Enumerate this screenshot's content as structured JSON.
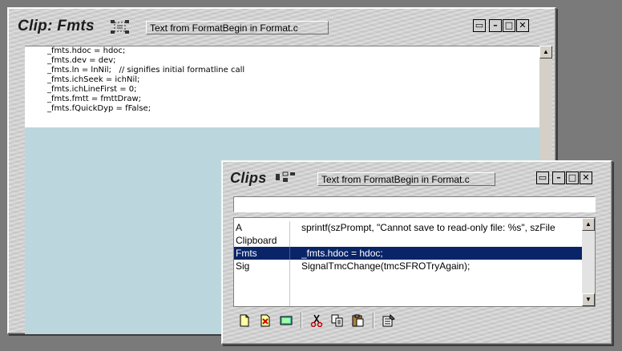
{
  "main_window": {
    "title": "Clip: Fmts",
    "description": "Text from FormatBegin in Format.c",
    "icon": "multi-clip-icon",
    "code_lines": [
      "_fmts.hdoc = hdoc;",
      "_fmts.dev = dev;",
      "_fmts.ln = lnNil;   // signifies initial formatline call",
      "_fmts.ichSeek = ichNil;",
      "_fmts.ichLineFirst = 0;",
      "_fmts.fmtt = fmttDraw;",
      "_fmts.fQuickDyp = fFalse;"
    ],
    "buttons": {
      "restore": "▭",
      "minimize": "–",
      "maximize": "□",
      "close": "✕"
    }
  },
  "clips_window": {
    "title": "Clips",
    "description": "Text from FormatBegin in Format.c",
    "icon": "clips-icon",
    "input_value": "",
    "rows": [
      {
        "name": "A",
        "text": "sprintf(szPrompt, \"Cannot save to read-only file: %s\", szFile"
      },
      {
        "name": "Clipboard",
        "text": ""
      },
      {
        "name": "Fmts",
        "text": "_fmts.hdoc = hdoc;"
      },
      {
        "name": "Sig",
        "text": "SignalTmcChange(tmcSFROTryAgain);"
      }
    ],
    "selected_index": 2,
    "buttons": {
      "restore": "▭",
      "minimize": "–",
      "maximize": "□",
      "close": "✕"
    },
    "toolbar": [
      "new-clip-icon",
      "delete-clip-icon",
      "edit-clip-icon",
      "cut-icon",
      "copy-icon",
      "paste-icon",
      "properties-icon"
    ]
  }
}
